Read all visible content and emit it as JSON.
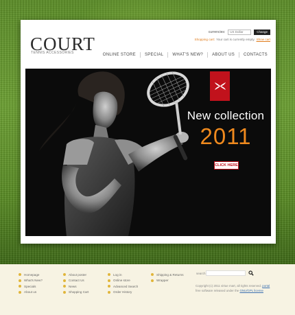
{
  "brand": {
    "name": "COURT",
    "tagline": "TENNIS ACCESSORIES"
  },
  "currency": {
    "label": "currencies:",
    "selected": "US Dollar",
    "button": "Change"
  },
  "cart": {
    "title": "Shopping cart:",
    "status": "Your cart is currently empty.",
    "link": "Show cart"
  },
  "nav": {
    "items": [
      "ONLINE STORE",
      "SPECIAL",
      "WHAT'S NEW?",
      "ABOUT US",
      "CONTACTS"
    ]
  },
  "banner": {
    "headline": "New collection",
    "year": "2011",
    "button": "CLICK HERE",
    "badge_icon": "under-armour-logo",
    "accent": "#f08a1e",
    "badge_color": "#c1121c"
  },
  "footer": {
    "col1": [
      "Homepage",
      "What's New?",
      "Specials",
      "About us"
    ],
    "col2": [
      "About poster",
      "Contact Us",
      "News",
      "Shopping Cart"
    ],
    "col3": [
      "Log in",
      "Online store",
      "Advanced Search",
      "Order History"
    ],
    "col4": [
      "Shipping & Returns",
      "Wrapper"
    ],
    "search_label": "search",
    "copyright_text": "Copyright (c) 2011 virtue mart, all rights reserved.",
    "copyright_link1": "portal",
    "copyright_line2": "free software released under the",
    "copyright_link2": "GNU/GPL license"
  }
}
